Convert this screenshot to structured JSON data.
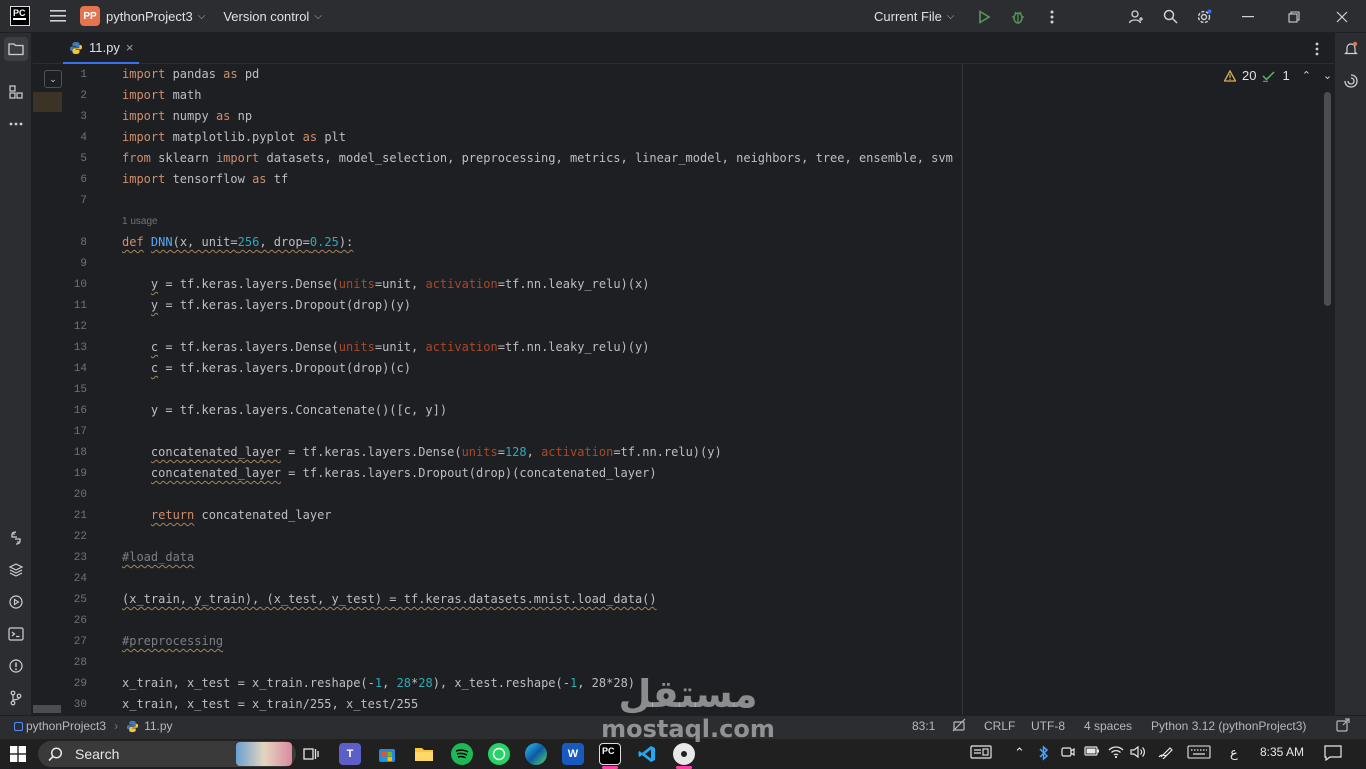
{
  "window": {
    "project_badge": "PP",
    "project_name": "pythonProject3",
    "version_control": "Version control",
    "run_config": "Current File",
    "logo_text": "PC"
  },
  "tabs": [
    {
      "label": "11.py"
    }
  ],
  "inspections": {
    "warnings": "20",
    "ok": "1"
  },
  "editor": {
    "usage_hint": "1 usage",
    "line_numbers": [
      "1",
      "2",
      "3",
      "4",
      "5",
      "6",
      "7",
      "8",
      "9",
      "10",
      "11",
      "12",
      "13",
      "14",
      "15",
      "16",
      "17",
      "18",
      "19",
      "20",
      "21",
      "22",
      "23",
      "24",
      "25",
      "26",
      "27",
      "28",
      "29",
      "30"
    ]
  },
  "status_bar": {
    "breadcrumb_project": "pythonProject3",
    "breadcrumb_file": "11.py",
    "position": "83:1",
    "line_separator": "CRLF",
    "encoding": "UTF-8",
    "indent": "4 spaces",
    "interpreter": "Python 3.12 (pythonProject3)"
  },
  "taskbar": {
    "search_label": "Search",
    "time": "8:35 AM",
    "lang": "ع"
  },
  "watermark": {
    "arabic": "مستقل",
    "latin": "mostaql.com"
  },
  "colors": {
    "keyword": "#cf8e6d",
    "number": "#2aacb8",
    "function": "#56a8f5",
    "param": "#aa4926",
    "comment": "#7a7e85",
    "accent": "#3574f0"
  }
}
